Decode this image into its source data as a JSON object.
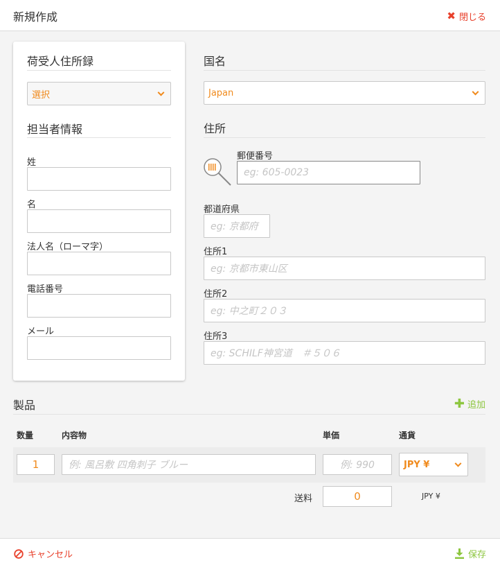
{
  "header": {
    "title": "新規作成",
    "close_label": "閉じる",
    "close_icon": "close-x-icon",
    "accent_red": "#e8412c"
  },
  "address_book": {
    "title": "荷受人住所録",
    "select_value": "選択"
  },
  "contact": {
    "title": "担当者情報",
    "last_name_label": "姓",
    "first_name_label": "名",
    "company_label": "法人名（ローマ字）",
    "phone_label": "電話番号",
    "email_label": "メール"
  },
  "country": {
    "title": "国名",
    "select_value": "Japan"
  },
  "address": {
    "title": "住所",
    "postal_label": "郵便番号",
    "postal_placeholder": "eg: 605-0023",
    "prefecture_label": "都道府県",
    "prefecture_placeholder": "eg: 京都府",
    "address1_label": "住所1",
    "address1_placeholder": "eg: 京都市東山区",
    "address2_label": "住所2",
    "address2_placeholder": "eg: 中之町２０３",
    "address3_label": "住所3",
    "address3_placeholder": "eg: SCHILF神宮道　＃５０６"
  },
  "products": {
    "title": "製品",
    "add_label": "追加",
    "columns": {
      "qty": "数量",
      "contents": "内容物",
      "unit_price": "単価",
      "currency": "通貨"
    },
    "row": {
      "qty": "1",
      "contents_placeholder": "例: 風呂敷 四角刺子 ブルー",
      "price_placeholder": "例: 990",
      "currency": "JPY ¥"
    },
    "shipping_label": "送料",
    "shipping_value": "0",
    "shipping_currency": "JPY ¥"
  },
  "footer": {
    "cancel_label": "キャンセル",
    "save_label": "保存",
    "accent_green": "#8dc63f",
    "accent_orange": "#f08a1c"
  }
}
